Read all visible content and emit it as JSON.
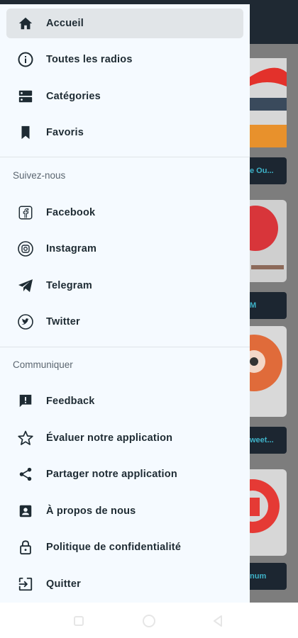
{
  "menu": {
    "items": [
      {
        "label": "Accueil",
        "icon": "home-icon",
        "active": true
      },
      {
        "label": "Toutes les radios",
        "icon": "info-icon"
      },
      {
        "label": "Catégories",
        "icon": "categories-icon"
      },
      {
        "label": "Favoris",
        "icon": "bookmark-icon"
      }
    ]
  },
  "follow": {
    "title": "Suivez-nous",
    "items": [
      {
        "label": "Facebook",
        "icon": "facebook-icon"
      },
      {
        "label": "Instagram",
        "icon": "instagram-icon"
      },
      {
        "label": "Telegram",
        "icon": "telegram-icon"
      },
      {
        "label": "Twitter",
        "icon": "twitter-icon"
      }
    ]
  },
  "communicate": {
    "title": "Communiquer",
    "items": [
      {
        "label": "Feedback",
        "icon": "feedback-icon"
      },
      {
        "label": "Évaluer notre application",
        "icon": "star-icon"
      },
      {
        "label": "Partager notre application",
        "icon": "share-icon"
      },
      {
        "label": "À propos de nous",
        "icon": "account-box-icon"
      },
      {
        "label": "Politique de confidentialité",
        "icon": "lock-icon"
      },
      {
        "label": "Quitter",
        "icon": "exit-icon"
      }
    ]
  },
  "background": {
    "buttons": [
      "e Ou...",
      "M",
      "weet...",
      "num"
    ]
  },
  "colors": {
    "drawer_bg": "#f5faff",
    "active_bg": "#e1e5e8",
    "text": "#1e2b33",
    "section_text": "#5b6670",
    "accent_teal": "#3fb3c9"
  }
}
